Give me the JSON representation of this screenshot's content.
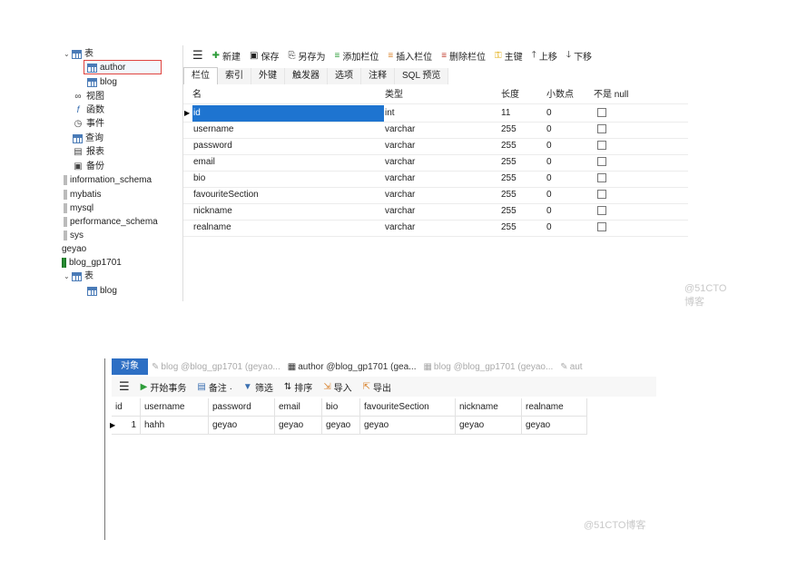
{
  "top": {
    "tree": [
      {
        "label": "表",
        "icon": "table-folder-icon"
      },
      {
        "label": "author",
        "icon": "table-icon"
      },
      {
        "label": "blog",
        "icon": "table-icon"
      },
      {
        "label": "视图",
        "icon": "view-icon"
      },
      {
        "label": "函数",
        "icon": "function-icon"
      },
      {
        "label": "事件",
        "icon": "event-icon"
      },
      {
        "label": "查询",
        "icon": "query-icon"
      },
      {
        "label": "报表",
        "icon": "report-icon"
      },
      {
        "label": "备份",
        "icon": "backup-icon"
      },
      {
        "label": "information_schema",
        "icon": "database-icon"
      },
      {
        "label": "mybatis",
        "icon": "database-icon"
      },
      {
        "label": "mysql",
        "icon": "database-icon"
      },
      {
        "label": "performance_schema",
        "icon": "database-icon"
      },
      {
        "label": "sys",
        "icon": "database-icon"
      },
      {
        "label": "geyao",
        "icon": ""
      },
      {
        "label": "blog_gp1701",
        "icon": "database-open-icon"
      },
      {
        "label": "表",
        "icon": "table-folder-icon"
      },
      {
        "label": "blog",
        "icon": "table-icon"
      }
    ],
    "toolbar": [
      {
        "label": "",
        "icon": "menu-icon"
      },
      {
        "label": "新建",
        "icon": "new-icon"
      },
      {
        "label": "保存",
        "icon": "save-icon"
      },
      {
        "label": "另存为",
        "icon": "save-as-icon"
      },
      {
        "label": "添加栏位",
        "icon": "add-field-icon"
      },
      {
        "label": "插入栏位",
        "icon": "insert-field-icon"
      },
      {
        "label": "删除栏位",
        "icon": "delete-field-icon"
      },
      {
        "label": "主键",
        "icon": "primary-key-icon"
      },
      {
        "label": "上移",
        "icon": "move-up-icon"
      },
      {
        "label": "下移",
        "icon": "move-down-icon"
      }
    ],
    "tabs": [
      "栏位",
      "索引",
      "外键",
      "触发器",
      "选项",
      "注释",
      "SQL 预览"
    ],
    "columns": [
      "名",
      "类型",
      "长度",
      "小数点",
      "不是 null"
    ],
    "fields": [
      {
        "name": "id",
        "type": "int",
        "length": "11",
        "decimals": "0"
      },
      {
        "name": "username",
        "type": "varchar",
        "length": "255",
        "decimals": "0"
      },
      {
        "name": "password",
        "type": "varchar",
        "length": "255",
        "decimals": "0"
      },
      {
        "name": "email",
        "type": "varchar",
        "length": "255",
        "decimals": "0"
      },
      {
        "name": "bio",
        "type": "varchar",
        "length": "255",
        "decimals": "0"
      },
      {
        "name": "favouriteSection",
        "type": "varchar",
        "length": "255",
        "decimals": "0"
      },
      {
        "name": "nickname",
        "type": "varchar",
        "length": "255",
        "decimals": "0"
      },
      {
        "name": "realname",
        "type": "varchar",
        "length": "255",
        "decimals": "0"
      }
    ],
    "watermark": "@51CTO博客"
  },
  "bottom": {
    "tabs": [
      {
        "label": "对象",
        "icon": ""
      },
      {
        "label": "blog @blog_gp1701 (geyao...",
        "icon": "query-icon"
      },
      {
        "label": "author @blog_gp1701 (gea...",
        "icon": "table-icon"
      },
      {
        "label": "blog @blog_gp1701 (geyao...",
        "icon": "table-icon"
      },
      {
        "label": "aut",
        "icon": "query-icon"
      }
    ],
    "toolbar": [
      {
        "label": "",
        "icon": "menu-icon"
      },
      {
        "label": "开始事务",
        "icon": "transaction-icon"
      },
      {
        "label": "备注 ·",
        "icon": "note-icon"
      },
      {
        "label": "筛选",
        "icon": "filter-icon"
      },
      {
        "label": "排序",
        "icon": "sort-icon"
      },
      {
        "label": "导入",
        "icon": "import-icon"
      },
      {
        "label": "导出",
        "icon": "export-icon"
      }
    ],
    "columns": [
      "id",
      "username",
      "password",
      "email",
      "bio",
      "favouriteSection",
      "nickname",
      "realname"
    ],
    "rows": [
      [
        "1",
        "hahh",
        "geyao",
        "geyao",
        "geyao",
        "geyao",
        "geyao",
        "geyao"
      ]
    ],
    "watermark": "@51CTO博客"
  }
}
